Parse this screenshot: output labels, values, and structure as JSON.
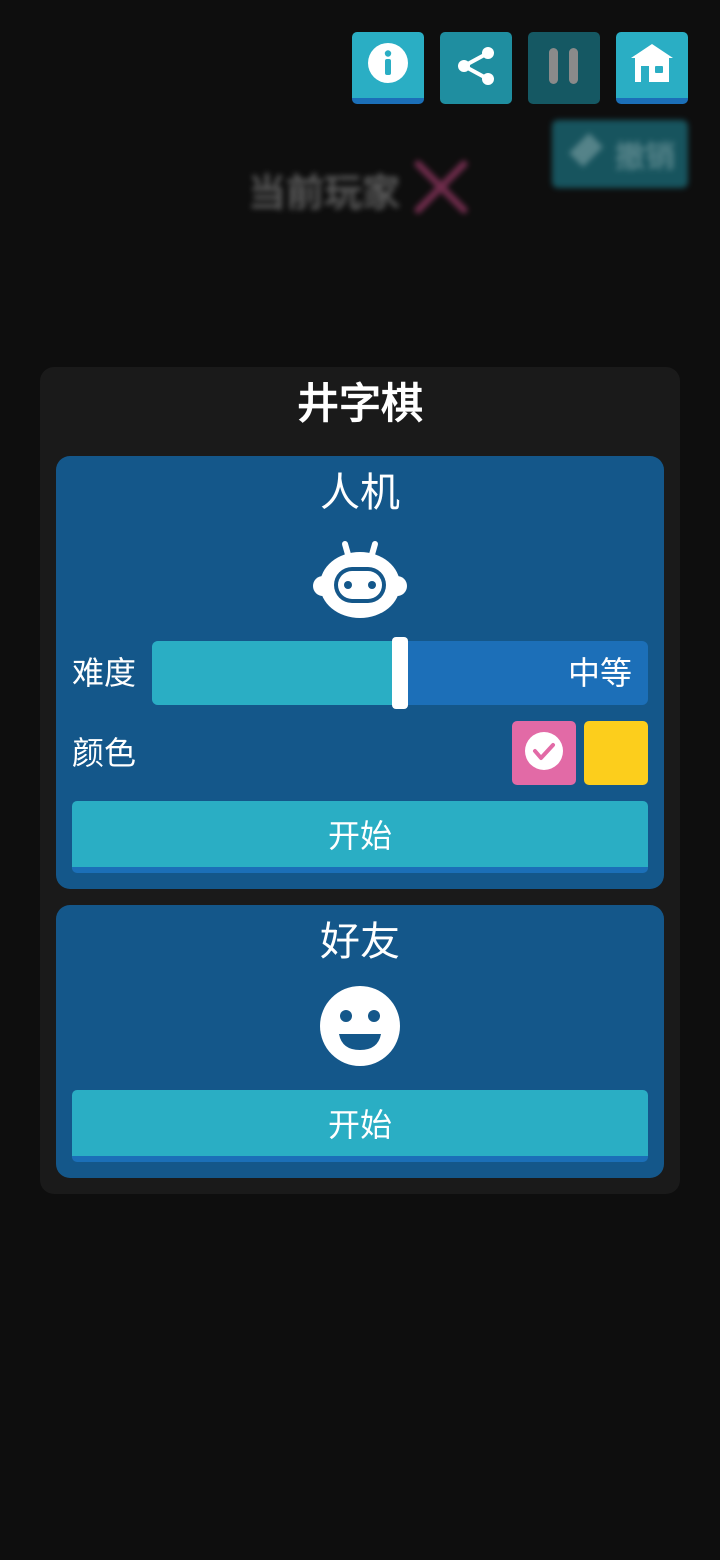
{
  "toolbar": {
    "buttons": [
      {
        "name": "info-button",
        "icon": "info-icon"
      },
      {
        "name": "share-button",
        "icon": "share-icon"
      },
      {
        "name": "pause-button",
        "icon": "pause-icon"
      },
      {
        "name": "home-button",
        "icon": "home-icon"
      }
    ]
  },
  "background": {
    "current_player_label": "当前玩家",
    "current_player_mark": "x-mark-icon",
    "undo_label": "撤销",
    "undo_icon": "eraser-icon"
  },
  "modal": {
    "title": "井字棋",
    "ai_card": {
      "title": "人机",
      "icon": "robot-icon",
      "difficulty_label": "难度",
      "difficulty_value": "中等",
      "difficulty_level": 0.5,
      "color_label": "颜色",
      "color_options": [
        {
          "color": "#e26aa6",
          "selected": true
        },
        {
          "color": "#fcce1c",
          "selected": false
        }
      ],
      "start_label": "开始"
    },
    "friend_card": {
      "title": "好友",
      "icon": "smiley-face-icon",
      "start_label": "开始"
    }
  },
  "colors": {
    "background": "#0e0e0e",
    "modal_bg": "#1a1a1a",
    "card_bg": "#14578a",
    "accent_cyan": "#2aaec4",
    "accent_blue": "#1c6fb8",
    "pink": "#e26aa6",
    "yellow": "#fcce1c"
  }
}
